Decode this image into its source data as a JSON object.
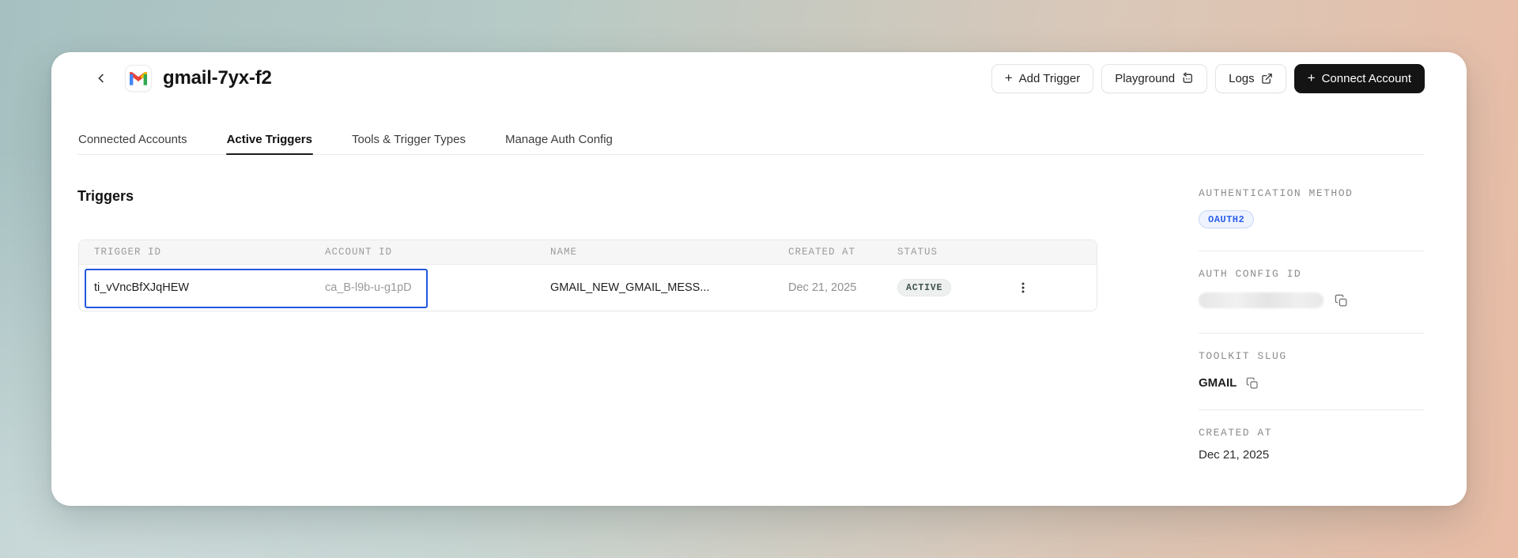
{
  "header": {
    "title": "gmail-7yx-f2",
    "buttons": {
      "add_trigger": "Add Trigger",
      "playground": "Playground",
      "logs": "Logs",
      "connect_account": "Connect Account"
    },
    "plus": "+"
  },
  "tabs": {
    "items": [
      {
        "label": "Connected Accounts",
        "active": false
      },
      {
        "label": "Active Triggers",
        "active": true
      },
      {
        "label": "Tools & Trigger Types",
        "active": false
      },
      {
        "label": "Manage Auth Config",
        "active": false
      }
    ]
  },
  "triggers_section": {
    "title": "Triggers",
    "table": {
      "headers": [
        "TRIGGER ID",
        "ACCOUNT ID",
        "NAME",
        "CREATED AT",
        "STATUS"
      ],
      "rows": [
        {
          "trigger_id": "ti_vVncBfXJqHEW",
          "account_id": "ca_B-l9b-u-g1pD",
          "name": "GMAIL_NEW_GMAIL_MESS...",
          "created_at": "Dec 21, 2025",
          "status": "ACTIVE"
        }
      ]
    }
  },
  "sidebar": {
    "authentication_method": {
      "label": "AUTHENTICATION METHOD",
      "value": "OAUTH2"
    },
    "auth_config_id": {
      "label": "AUTH CONFIG ID",
      "value_redacted": true
    },
    "toolkit_slug": {
      "label": "TOOLKIT SLUG",
      "value": "GMAIL"
    },
    "created_at": {
      "label": "CREATED AT",
      "value": "Dec 21, 2025"
    }
  },
  "colors": {
    "selection_blue": "#2456e0",
    "oauth2_text": "#2e5fe8",
    "oauth2_bg": "#eef3fe",
    "status_bg": "#eef0ef",
    "status_text": "#3f5249",
    "connect_button_bg": "#141414",
    "gmail_blue": "#4285F4",
    "gmail_red": "#EA4335",
    "gmail_yellow": "#FBBC04",
    "gmail_green": "#34A853",
    "bg_left": "#a6c0c1",
    "bg_right": "#e9bca5"
  }
}
